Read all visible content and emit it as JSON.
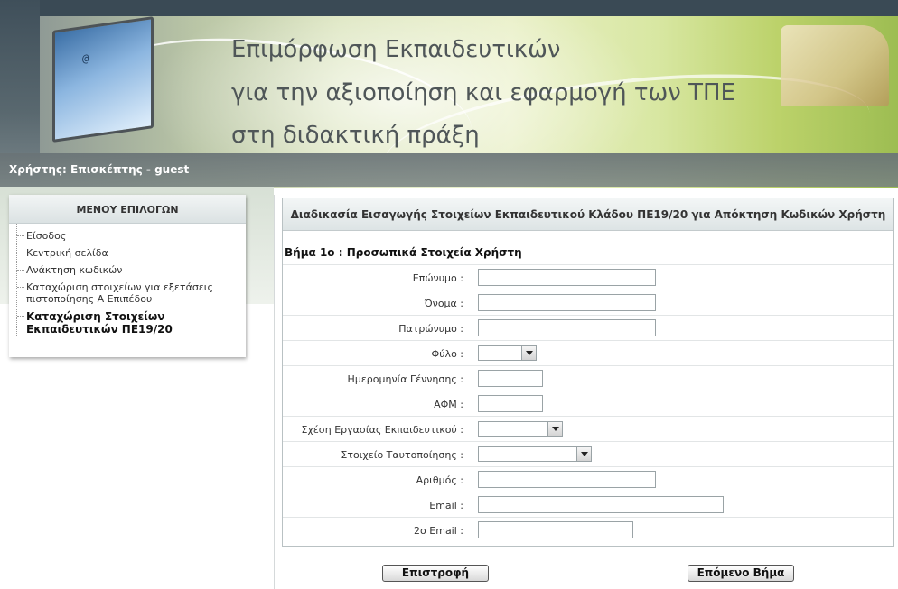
{
  "header": {
    "title_line1": "Επιμόρφωση Εκπαιδευτικών",
    "title_line2": "για την αξιοποίηση και εφαρμογή των ΤΠΕ",
    "title_line3": "στη διδακτική πράξη",
    "user_text": "Χρήστης: Επισκέπτης - guest"
  },
  "menu": {
    "heading": "ΜΕΝΟΥ ΕΠΙΛΟΓΩΝ",
    "items": [
      {
        "label": "Είσοδος"
      },
      {
        "label": "Κεντρική σελίδα"
      },
      {
        "label": "Ανάκτηση κωδικών"
      },
      {
        "label": "Καταχώριση στοιχείων για εξετάσεις πιστοποίησης Α Επιπέδου"
      },
      {
        "label": "Καταχώριση Στοιχείων Εκπαιδευτικών ΠΕ19/20",
        "active": true
      }
    ]
  },
  "form": {
    "panel_title": "Διαδικασία Εισαγωγής Στοιχείων Εκπαιδευτικού Κλάδου ΠΕ19/20 για Απόκτηση Κωδικών Χρήστη",
    "step_title": "Βήμα 1ο : Προσωπικά Στοιχεία Χρήστη",
    "fields": {
      "surname": {
        "label": "Επώνυμο :",
        "value": ""
      },
      "name": {
        "label": "Όνομα :",
        "value": ""
      },
      "father_name": {
        "label": "Πατρώνυμο :",
        "value": ""
      },
      "gender": {
        "label": "Φύλο :",
        "value": ""
      },
      "birth_date": {
        "label": "Ημερομηνία Γέννησης :",
        "value": ""
      },
      "afm": {
        "label": "ΑΦΜ :",
        "value": ""
      },
      "employment": {
        "label": "Σχέση Εργασίας Εκπαιδευτικού :",
        "value": ""
      },
      "id_type": {
        "label": "Στοιχείο Ταυτοποίησης :",
        "value": ""
      },
      "id_number": {
        "label": "Αριθμός :",
        "value": ""
      },
      "email": {
        "label": "Email :",
        "value": ""
      },
      "email2": {
        "label": "2ο Email :",
        "value": ""
      }
    },
    "back_label": "Επιστροφή",
    "next_label": "Επόμενο Βήμα"
  }
}
